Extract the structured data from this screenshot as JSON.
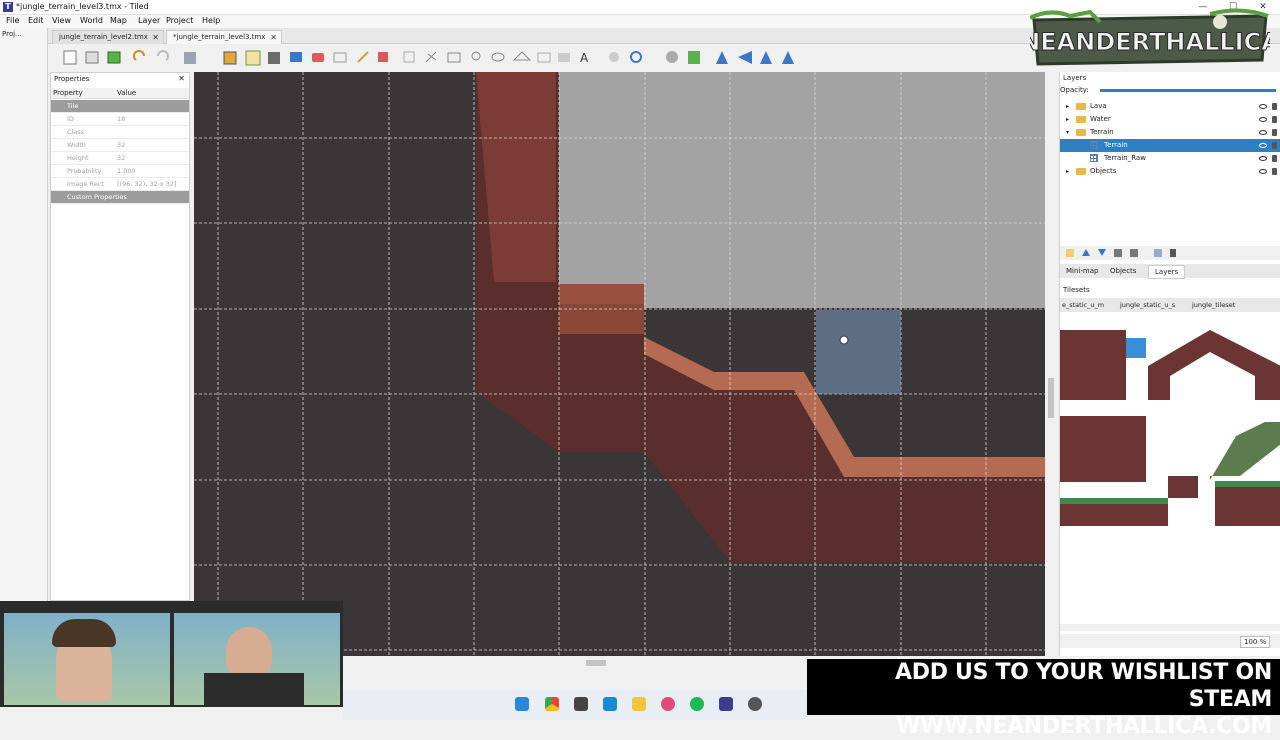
{
  "window": {
    "title": "*jungle_terrain_level3.tmx - Tiled"
  },
  "menu": [
    "File",
    "Edit",
    "View",
    "World",
    "Map",
    "Layer",
    "Project",
    "Help"
  ],
  "tabs": [
    {
      "label": "jungle_terrain_level2.tmx",
      "active": false
    },
    {
      "label": "*jungle_terrain_level3.tmx",
      "active": true
    }
  ],
  "project_tab": "Proj...",
  "properties": {
    "title": "Properties",
    "col_property": "Property",
    "col_value": "Value",
    "group_tile": "Tile",
    "rows": [
      {
        "k": "ID",
        "v": "18"
      },
      {
        "k": "Class",
        "v": ""
      },
      {
        "k": "Width",
        "v": "32"
      },
      {
        "k": "Height",
        "v": "32"
      },
      {
        "k": "Probability",
        "v": "1.000"
      },
      {
        "k": "Image Rect",
        "v": "[(96, 32), 32 x 32]"
      }
    ],
    "custom": "Custom Properties"
  },
  "layers": {
    "title": "Layers",
    "opacity_label": "Opacity:",
    "items": [
      {
        "name": "Lava",
        "kind": "folder",
        "indent": 0,
        "selected": false
      },
      {
        "name": "Water",
        "kind": "folder",
        "indent": 0,
        "selected": false
      },
      {
        "name": "Terrain",
        "kind": "folder",
        "indent": 0,
        "selected": false,
        "expanded": true
      },
      {
        "name": "Terrain",
        "kind": "tile",
        "indent": 1,
        "selected": true
      },
      {
        "name": "Terrain_Raw",
        "kind": "tile",
        "indent": 1,
        "selected": false
      },
      {
        "name": "Objects",
        "kind": "folder",
        "indent": 0,
        "selected": false
      }
    ],
    "bottom_tabs": [
      "Mini-map",
      "Objects",
      "Layers"
    ]
  },
  "tilesets": {
    "title": "Tilesets",
    "tabs": [
      "e_static_u_m",
      "jungle_static_u_s",
      "jungle_tileset"
    ],
    "zoom": "100 %"
  },
  "branding": {
    "logo_text": "NEANDERTHALLICA",
    "banner_line1": "ADD US TO YOUR WISHLIST ON STEAM",
    "banner_line2": "WWW.NEANDERTHALLICA.COM"
  },
  "colors": {
    "accent": "#2f7fc1",
    "canvas_bg": "#a0a0a0",
    "terrain_dark": "#4a2626",
    "terrain_mid": "#8a4a3a",
    "terrain_light": "#b8705a"
  }
}
